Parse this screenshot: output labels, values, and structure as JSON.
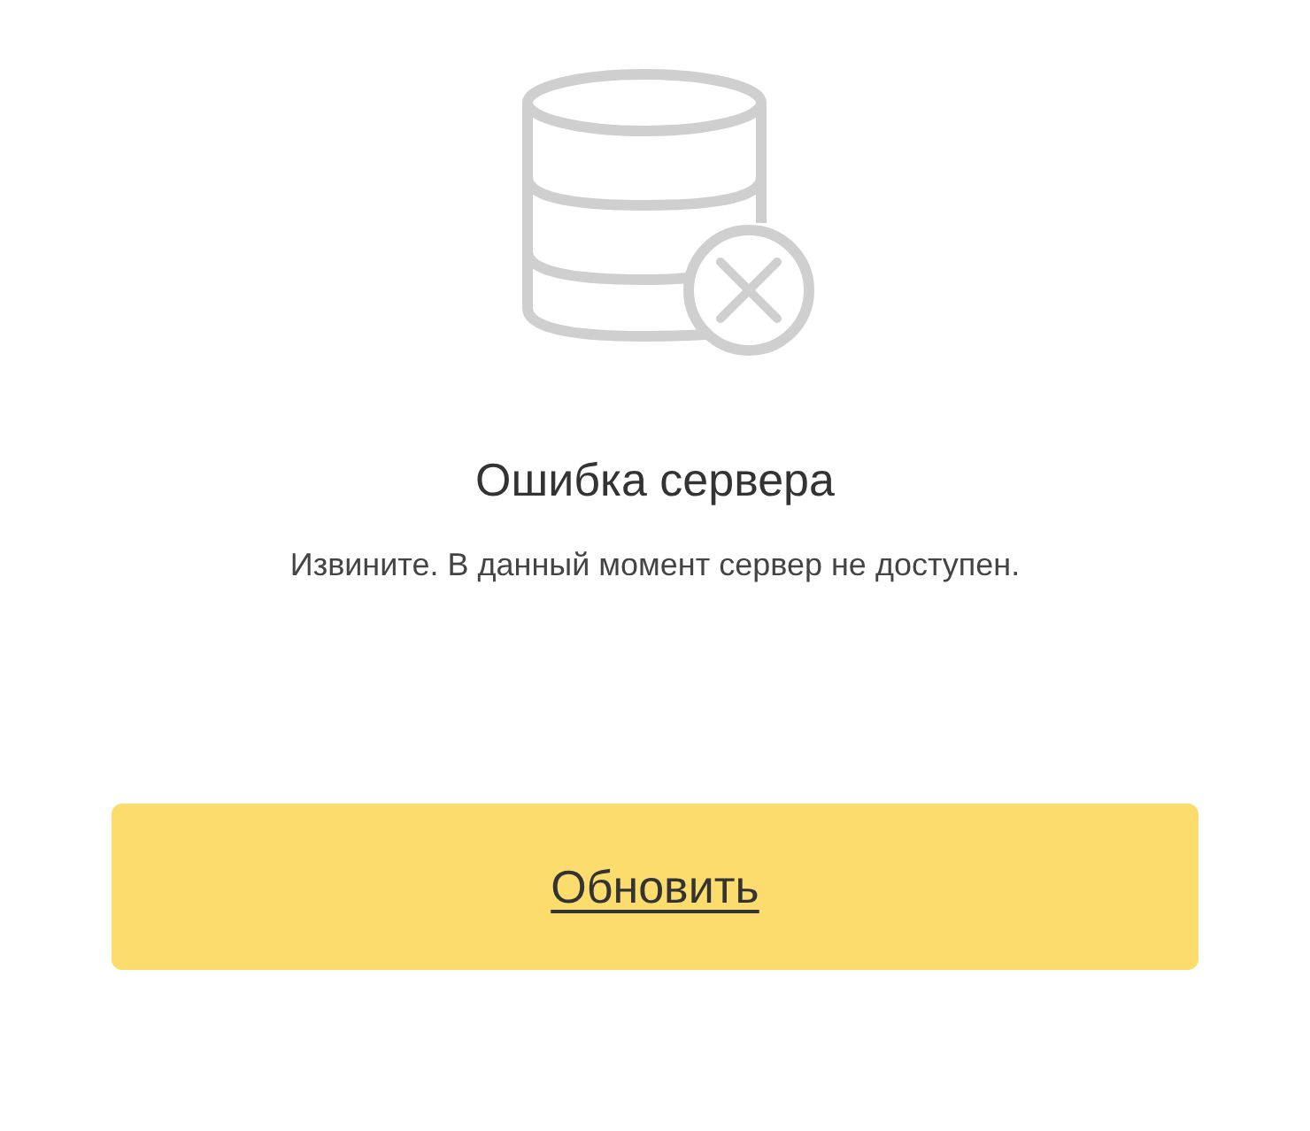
{
  "error": {
    "title": "Ошибка сервера",
    "message": "Извините. В данный момент сервер не доступен."
  },
  "button": {
    "label": "Обновить"
  }
}
